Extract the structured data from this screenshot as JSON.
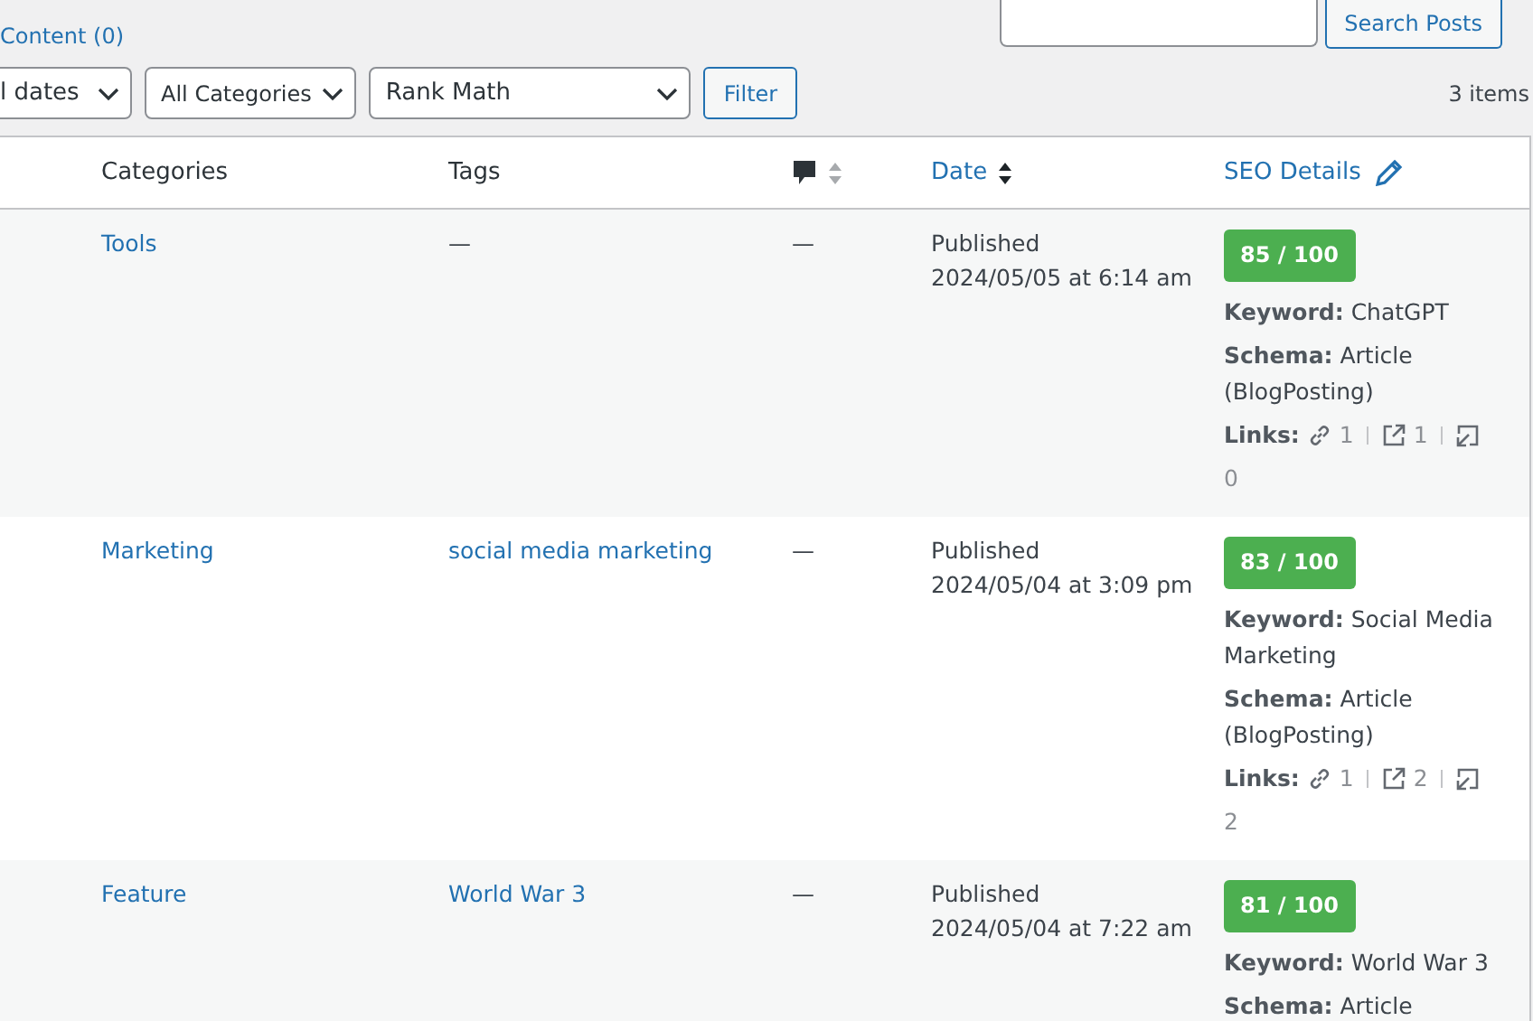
{
  "status_link": "Content (0)",
  "search": {
    "button": "Search Posts"
  },
  "filters": [
    {
      "label": "l dates"
    },
    {
      "label": "All Categories"
    },
    {
      "label": "Rank Math"
    }
  ],
  "filter_button": "Filter",
  "items_count": "3 items",
  "columns": [
    {
      "kind": "plain",
      "label": "Categories"
    },
    {
      "kind": "plain",
      "label": "Tags"
    },
    {
      "kind": "comments"
    },
    {
      "kind": "sortable",
      "label": "Date"
    },
    {
      "kind": "editable",
      "label": "SEO Details"
    }
  ],
  "rows": [
    {
      "category": "Tools",
      "tags": "—",
      "comments": "—",
      "status": "Published",
      "date": "2024/05/05 at 6:14 am",
      "seo": {
        "score": "85 / 100",
        "keyword_label": "Keyword:",
        "keyword": "ChatGPT",
        "schema_label": "Schema:",
        "schema": "Article",
        "schema_type": "(BlogPosting)",
        "links_label": "Links:",
        "internal": "1",
        "external": "1",
        "incoming": "0"
      }
    },
    {
      "category": "Marketing",
      "tags": "social media marketing",
      "comments": "—",
      "status": "Published",
      "date": "2024/05/04 at 3:09 pm",
      "seo": {
        "score": "83 / 100",
        "keyword_label": "Keyword:",
        "keyword": "Social Media Marketing",
        "schema_label": "Schema:",
        "schema": "Article",
        "schema_type": "(BlogPosting)",
        "links_label": "Links:",
        "internal": "1",
        "external": "2",
        "incoming": "2"
      }
    },
    {
      "category": "Feature",
      "tags": "World War 3",
      "comments": "—",
      "status": "Published",
      "date": "2024/05/04 at 7:22 am",
      "seo": {
        "score": "81 / 100",
        "keyword_label": "Keyword:",
        "keyword": "World War 3",
        "schema_label": "Schema:",
        "schema": "Article"
      }
    }
  ]
}
